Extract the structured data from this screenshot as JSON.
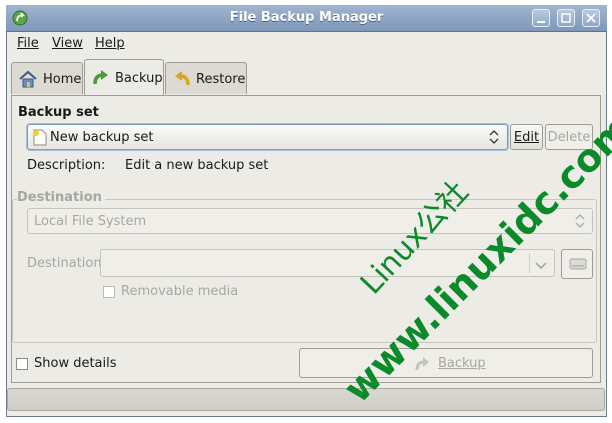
{
  "window": {
    "title": "File Backup Manager"
  },
  "menu": [
    {
      "label": "File"
    },
    {
      "label": "View"
    },
    {
      "label": "Help"
    }
  ],
  "tabs": [
    {
      "label": "Home",
      "icon": "home-icon"
    },
    {
      "label": "Backup",
      "icon": "backup-arrow-icon",
      "active": true
    },
    {
      "label": "Restore",
      "icon": "restore-arrow-icon"
    }
  ],
  "backup_set": {
    "heading": "Backup set",
    "selected": "New backup set",
    "edit_label": "Edit",
    "delete_label": "Delete",
    "description_label": "Description:",
    "description_value": "Edit a new backup set"
  },
  "destination": {
    "frame_title": "Destination",
    "type_selected": "Local File System",
    "field_label": "Destination:",
    "field_value": "",
    "removable_label": "Removable media",
    "removable_checked": false
  },
  "footer": {
    "show_details_label": "Show details",
    "show_details_checked": false,
    "backup_button_label": "Backup"
  },
  "watermark": {
    "line1": "Linux公社",
    "line2": "www.linuxidc.com"
  },
  "colors": {
    "titlebar": "#8aa2c2",
    "window_bg": "#ecebe6",
    "watermark": "#0b8a2a"
  }
}
